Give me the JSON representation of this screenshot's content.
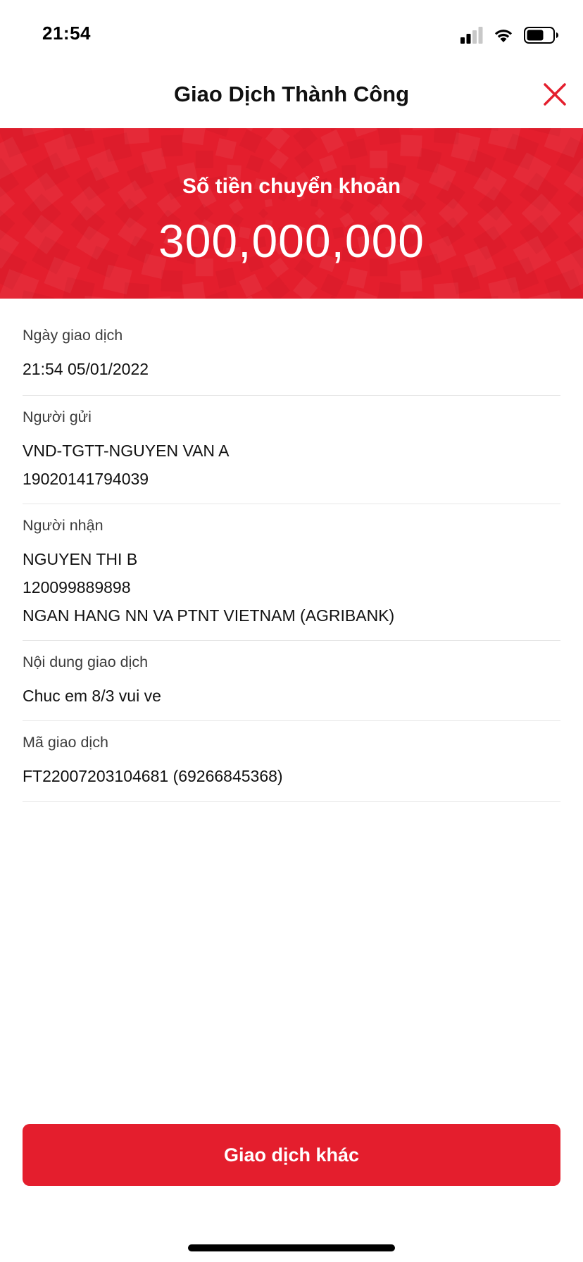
{
  "status_bar": {
    "time": "21:54",
    "icons": [
      "cellular-signal-icon",
      "wifi-icon",
      "battery-icon"
    ]
  },
  "header": {
    "title": "Giao Dịch Thành Công",
    "close_icon": "close-icon"
  },
  "banner": {
    "label": "Số tiền chuyển khoản",
    "amount": "300,000,000"
  },
  "details": {
    "date": {
      "label": "Ngày giao dịch",
      "value": "21:54 05/01/2022"
    },
    "sender": {
      "label": "Người gửi",
      "name": "VND-TGTT-NGUYEN VAN A",
      "account": "19020141794039"
    },
    "receiver": {
      "label": "Người nhận",
      "name": "NGUYEN THI B",
      "account": "120099889898",
      "bank": "NGAN HANG NN VA PTNT VIETNAM (AGRIBANK)"
    },
    "content": {
      "label": "Nội dung giao dịch",
      "value": "Chuc em 8/3 vui ve"
    },
    "code": {
      "label": "Mã giao dịch",
      "value": "FT22007203104681 (69266845368)"
    }
  },
  "actions": {
    "other_transaction_label": "Giao dịch khác"
  },
  "colors": {
    "brand_red": "#e41e2d",
    "divider": "#e6e6e6",
    "text_primary": "#111111",
    "text_label": "#3c3c3c"
  }
}
